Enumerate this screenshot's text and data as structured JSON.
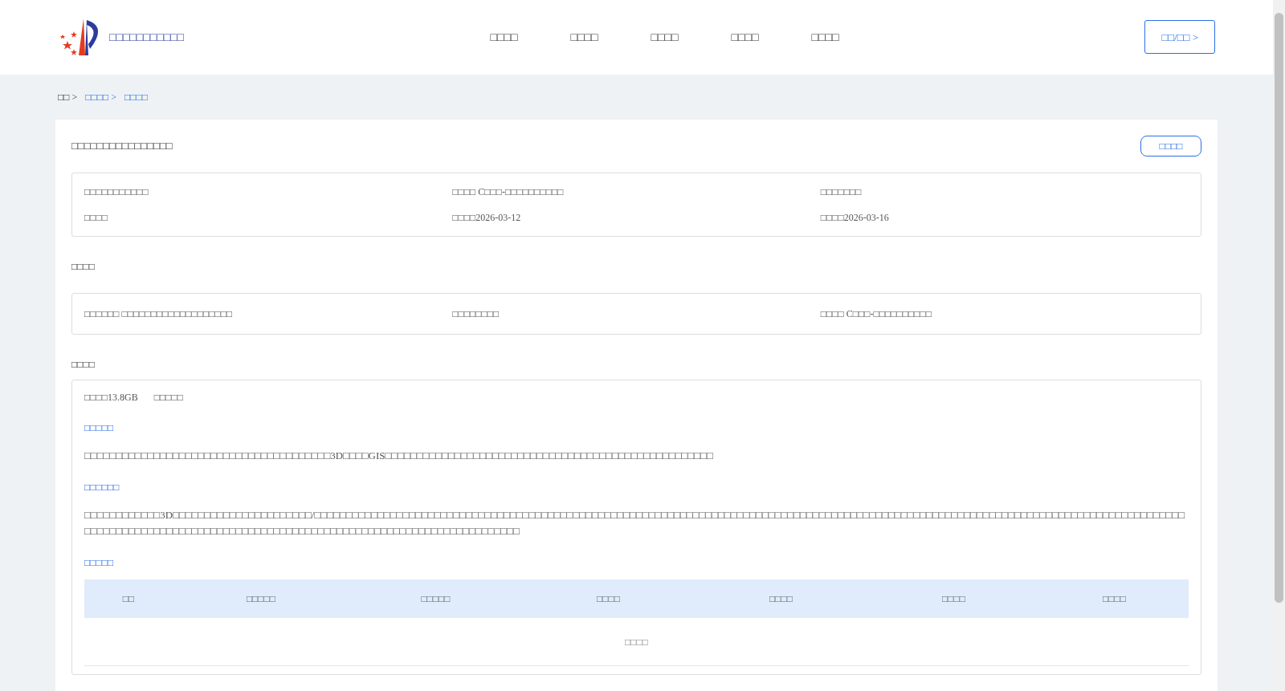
{
  "header": {
    "site_name": "□□□□□□□□□□□",
    "nav": [
      "□□□□",
      "□□□□",
      "□□□□",
      "□□□□",
      "□□□□"
    ],
    "login_button": "□□/□□ >"
  },
  "breadcrumb": [
    {
      "label": "□□ >",
      "link": false
    },
    {
      "label": "□□□□ >",
      "link": true
    },
    {
      "label": "□□□□",
      "link": true
    }
  ],
  "card": {
    "title": "□□□□□□□□□□□□□□□□",
    "action_button": "□□□□",
    "info_rows": [
      [
        "□□□□□□□□□□□",
        "□□□□ C□□□-□□□□□□□□□□",
        "□□□□□□□"
      ],
      [
        "□□□□",
        "□□□□2026-03-12",
        "□□□□2026-03-16"
      ]
    ],
    "section_1": {
      "title": "□□□□",
      "cells": [
        "□□□□□□ □□□□□□□□□□□□□□□□□□□",
        "□□□□□□□□",
        "□□□□ C□□□-□□□□□□□□□□"
      ]
    },
    "section_2": {
      "title": "□□□□",
      "size": "□□□□13.8GB",
      "format": "□□□□□",
      "blocks": [
        {
          "heading": "□□□□□",
          "text": "□□□□□□□□□□□□□□□□□□□□□□□□□□□□□□□□□□□□□□□3D□□□□GIS□□□□□□□□□□□□□□□□□□□□□□□□□□□□□□□□□□□□□□□□□□□□□□□□□□□□"
        },
        {
          "heading": "□□□□□□",
          "text": "□□□□□□□□□□□□3D□□□□□□□□□□□□□□□□□□□□□□/□□□□□□□□□□□□□□□□□□□□□□□□□□□□□□□□□□□□□□□□□□□□□□□□□□□□□□□□□□□□□□□□□□□□□□□□□□□□□□□□□□□□□□□□□□□□□□□□□□□□□□□□□□□□□□□□□□□□□□□□□□□□□□□□□□□□□□□□□□□□□□□□□□□□□□□□□□□□□□□□□□□□□□□□□□□□□□□□□□□□□□□□□□□□□□□□□□□□□□□□□□□□□□□"
        }
      ],
      "table_heading": "□□□□□",
      "table": {
        "columns": [
          "□□",
          "□□□□□",
          "□□□□□",
          "□□□□",
          "□□□□",
          "□□□□",
          "□□□□"
        ],
        "empty_text": "□□□□"
      }
    }
  }
}
